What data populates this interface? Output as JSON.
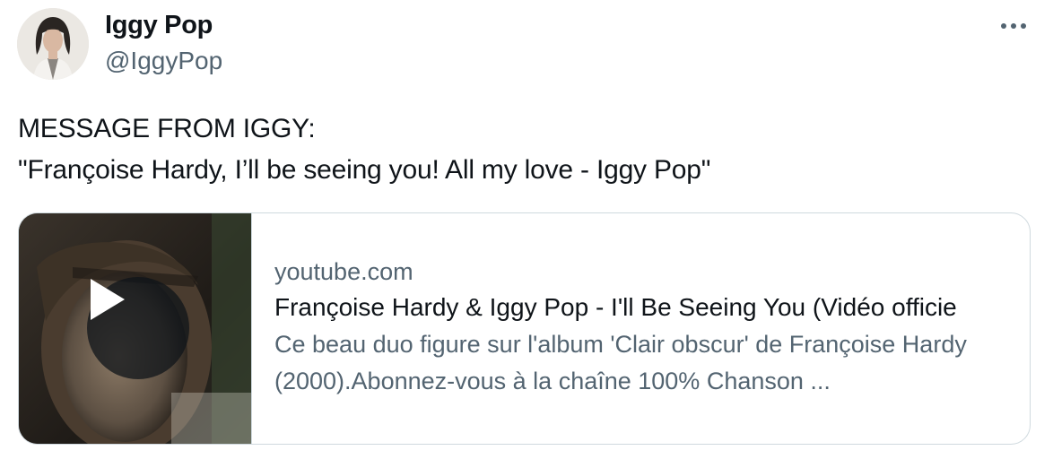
{
  "author": {
    "name": "Iggy Pop",
    "handle": "@IggyPop"
  },
  "tweet": {
    "lines": [
      "MESSAGE FROM IGGY:",
      "\"Françoise Hardy, I’ll be seeing you! All my love - Iggy Pop\""
    ]
  },
  "card": {
    "domain": "youtube.com",
    "title": "Françoise Hardy & Iggy Pop - I'll Be Seeing You (Vidéo officie",
    "description": "Ce beau duo figure sur l'album 'Clair obscur' de Françoise Hardy (2000).Abonnez-vous à la chaîne 100% Chanson ..."
  },
  "icons": {
    "more": "more-icon",
    "play": "play-icon"
  },
  "colors": {
    "text": "#0f1419",
    "secondary": "#536471",
    "border": "#cfd9de"
  }
}
